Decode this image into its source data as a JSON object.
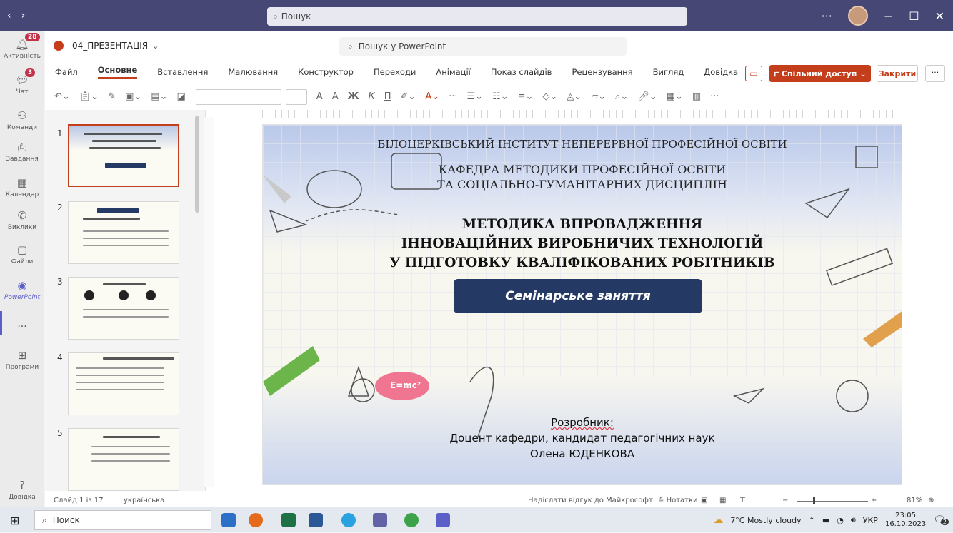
{
  "teams": {
    "search_placeholder": "Пошук",
    "rail": [
      {
        "label": "Активність",
        "icon": "bell-icon",
        "badge": "28"
      },
      {
        "label": "Чат",
        "icon": "chat-icon",
        "badge": "3"
      },
      {
        "label": "Команди",
        "icon": "teams-icon"
      },
      {
        "label": "Завдання",
        "icon": "tasks-icon"
      },
      {
        "label": "Календар",
        "icon": "calendar-icon"
      },
      {
        "label": "Виклики",
        "icon": "phone-icon"
      },
      {
        "label": "Файли",
        "icon": "file-icon"
      },
      {
        "label": "PowerPoint",
        "icon": "powerpoint-icon"
      },
      {
        "label": "...",
        "icon": "more-icon"
      },
      {
        "label": "Програми",
        "icon": "apps-icon"
      },
      {
        "label": "Довідка",
        "icon": "help-icon"
      }
    ]
  },
  "ppt": {
    "doc_name": "04_ПРЕЗЕНТАЦІЯ",
    "search_placeholder": "Пошук у PowerPoint",
    "menu": [
      "Файл",
      "Основне",
      "Вставлення",
      "Малювання",
      "Конструктор",
      "Переходи",
      "Анімації",
      "Показ слайдів",
      "Рецензування",
      "Вигляд",
      "Довідка"
    ],
    "menu_selected": "Основне",
    "share_label": "Спільний доступ",
    "close_label": "Закрити",
    "bold_glyph": "Ж",
    "italic_glyph": "К",
    "underline_glyph": "П",
    "font_grow": "A",
    "more": "···"
  },
  "thumbnails": [
    "1",
    "2",
    "3",
    "4",
    "5"
  ],
  "slide": {
    "institute": "БІЛОЦЕРКІВСЬКИЙ ІНСТИТУТ НЕПЕРЕРВНОЇ ПРОФЕСІЙНОЇ ОСВІТИ",
    "dept_1": "КАФЕДРА МЕТОДИКИ ПРОФЕСІЙНОЇ ОСВІТИ",
    "dept_2": "ТА СОЦІАЛЬНО-ГУМАНІТАРНИХ ДИСЦИПЛІН",
    "title_1": "МЕТОДИКА ВПРОВАДЖЕННЯ",
    "title_2": "ІННОВАЦІЙНИХ ВИРОБНИЧИХ ТЕХНОЛОГІЙ",
    "title_3": "У ПІДГОТОВКУ КВАЛІФІКОВАНИХ РОБІТНИКІВ",
    "button": "Семінарське заняття",
    "author_label": "Розробник:",
    "author_pos": "Доцент кафедри, кандидат педагогічних наук",
    "author_name": "Олена ЮДЕНКОВА",
    "formula": "E=mc²"
  },
  "status": {
    "slide_info": "Слайд 1 із 17",
    "language": "українська",
    "feedback": "Надіслати відгук до Майкрософт",
    "notes": "Нотатки",
    "zoom": "81%"
  },
  "taskbar": {
    "search": "Поиск",
    "weather": "7°C  Mostly cloudy",
    "lang": "УКР",
    "time": "23:05",
    "date": "16.10.2023",
    "notif": "2"
  }
}
